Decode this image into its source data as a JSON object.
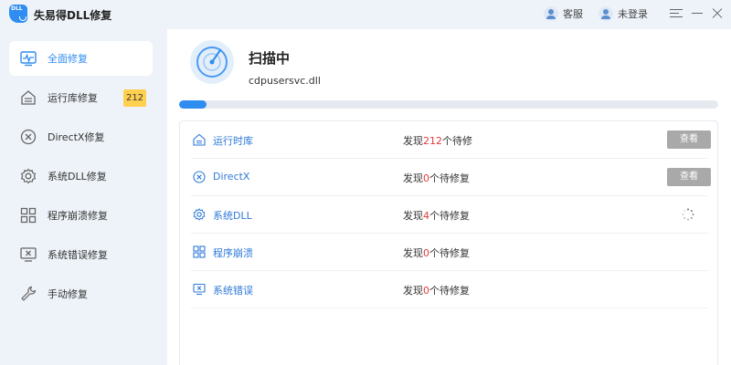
{
  "titlebar": {
    "logo_text": "DLL",
    "title": "失易得DLL修复",
    "service_label": "客服",
    "login_label": "未登录"
  },
  "sidebar": {
    "items": [
      {
        "label": "全面修复",
        "icon": "pulse-monitor-icon",
        "active": true
      },
      {
        "label": "运行库修复",
        "icon": "runtime-library-icon",
        "badge": "212"
      },
      {
        "label": "DirectX修复",
        "icon": "x-circle-icon"
      },
      {
        "label": "系统DLL修复",
        "icon": "gear-icon"
      },
      {
        "label": "程序崩溃修复",
        "icon": "grid-icon"
      },
      {
        "label": "系统错误修复",
        "icon": "monitor-error-icon"
      },
      {
        "label": "手动修复",
        "icon": "wrench-icon"
      }
    ]
  },
  "scan": {
    "title": "扫描中",
    "current_file": "cdpusersvc.dll",
    "progress": 0.05
  },
  "results": [
    {
      "name": "运行时库",
      "icon": "runtime-library-icon",
      "status_prefix": "发现",
      "count": "212",
      "status_suffix": "个待修",
      "action": "查看"
    },
    {
      "name": "DirectX",
      "icon": "x-circle-icon",
      "status_prefix": "发现",
      "count": "0",
      "status_suffix": "个待修复",
      "action": "查看"
    },
    {
      "name": "系统DLL",
      "icon": "gear-icon",
      "status_prefix": "发现",
      "count": "4",
      "status_suffix": "个待修复",
      "action": "loading"
    },
    {
      "name": "程序崩溃",
      "icon": "grid-icon",
      "status_prefix": "发现",
      "count": "0",
      "status_suffix": "个待修复",
      "action": ""
    },
    {
      "name": "系统错误",
      "icon": "monitor-error-icon",
      "status_prefix": "发现",
      "count": "0",
      "status_suffix": "个待修复",
      "action": ""
    }
  ],
  "colors": {
    "accent": "#2f8cf0",
    "count_red": "#e23b3b",
    "badge_yellow": "#ffcf4f",
    "button_gray": "#a9a9a9"
  }
}
